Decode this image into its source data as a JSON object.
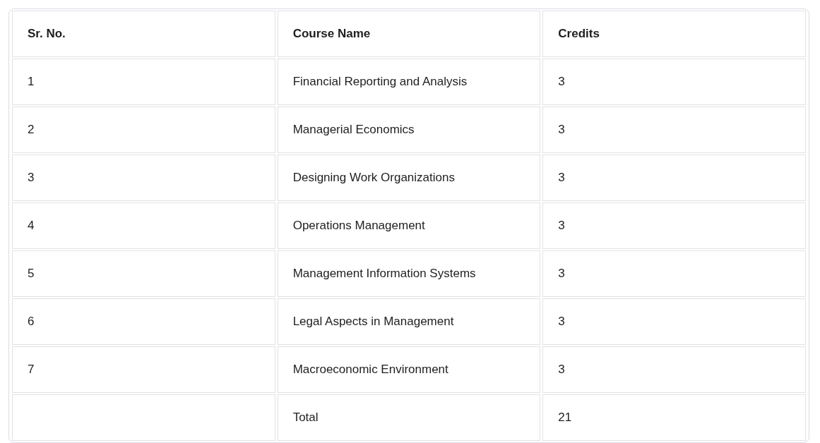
{
  "table": {
    "columns": [
      "Sr. No.",
      "Course Name",
      "Credits"
    ],
    "rows": [
      {
        "sr_no": "1",
        "course": "Financial Reporting and Analysis",
        "credits": "3"
      },
      {
        "sr_no": "2",
        "course": "Managerial Economics",
        "credits": "3"
      },
      {
        "sr_no": "3",
        "course": "Designing Work Organizations",
        "credits": "3"
      },
      {
        "sr_no": "4",
        "course": "Operations Management",
        "credits": "3"
      },
      {
        "sr_no": "5",
        "course": "Management Information Systems",
        "credits": "3"
      },
      {
        "sr_no": "6",
        "course": "Legal Aspects in Management",
        "credits": "3"
      },
      {
        "sr_no": "7",
        "course": "Macroeconomic Environment",
        "credits": "3"
      },
      {
        "course": "Total",
        "credits": "21"
      }
    ]
  }
}
